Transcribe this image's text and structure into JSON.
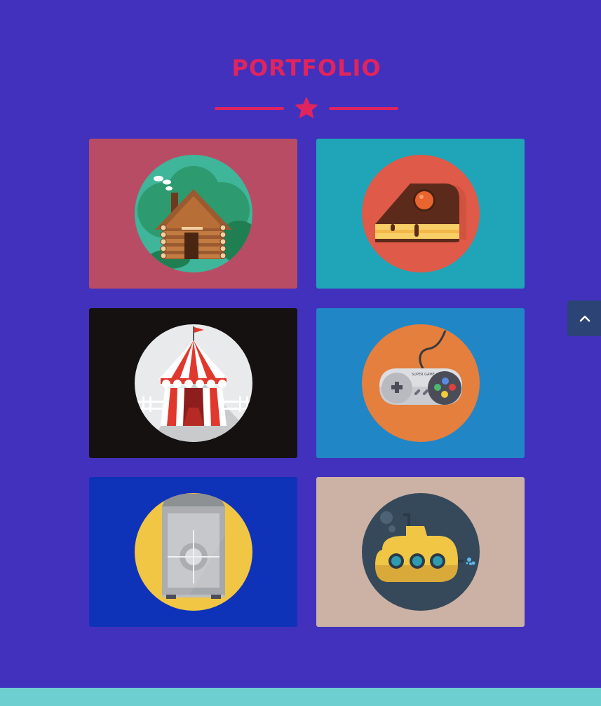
{
  "section": {
    "title": "PORTFOLIO",
    "accent_color": "#e0245e",
    "divider_icon": "star-icon"
  },
  "portfolio": {
    "items": [
      {
        "illustration": "log-cabin-icon",
        "bg": "#b94c65",
        "circle": "#3fb59a"
      },
      {
        "illustration": "cake-slice-icon",
        "bg": "#20a5b8",
        "circle": "#df5a48"
      },
      {
        "illustration": "circus-tent-icon",
        "bg": "#151111",
        "circle": "#e9eaec"
      },
      {
        "illustration": "game-controller-icon",
        "bg": "#2186c6",
        "circle": "#e57f3d"
      },
      {
        "illustration": "safe-icon",
        "bg": "#0f33b8",
        "circle": "#f0c644"
      },
      {
        "illustration": "submarine-icon",
        "bg": "#ccb1a5",
        "circle": "#35495b"
      }
    ]
  },
  "back_to_top": {
    "icon": "chevron-up-icon"
  }
}
